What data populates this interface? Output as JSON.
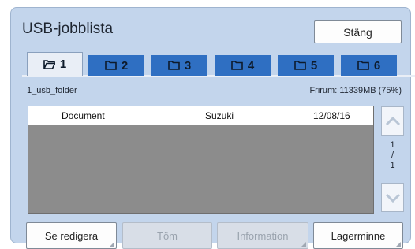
{
  "window": {
    "title": "USB-jobblista",
    "close_label": "Stäng"
  },
  "tabs": [
    {
      "label": "1",
      "active": true
    },
    {
      "label": "2",
      "active": false
    },
    {
      "label": "3",
      "active": false
    },
    {
      "label": "4",
      "active": false
    },
    {
      "label": "5",
      "active": false
    },
    {
      "label": "6",
      "active": false
    }
  ],
  "folder": {
    "name": "1_usb_folder",
    "free_space": "Frirum: 11339MB (75%)"
  },
  "jobs": [
    {
      "document": "Document",
      "owner": "Suzuki",
      "date": "12/08/16"
    }
  ],
  "pager": {
    "current": "1",
    "separator": "/",
    "total": "1"
  },
  "buttons": {
    "edit": "Se redigera",
    "empty": "Töm",
    "info": "Information",
    "storage": "Lagerminne"
  },
  "colors": {
    "panel": "#c3d5ec",
    "tab": "#2f6fc2",
    "tab_active": "#e9eef6",
    "list_bg": "#8c8c8c"
  }
}
